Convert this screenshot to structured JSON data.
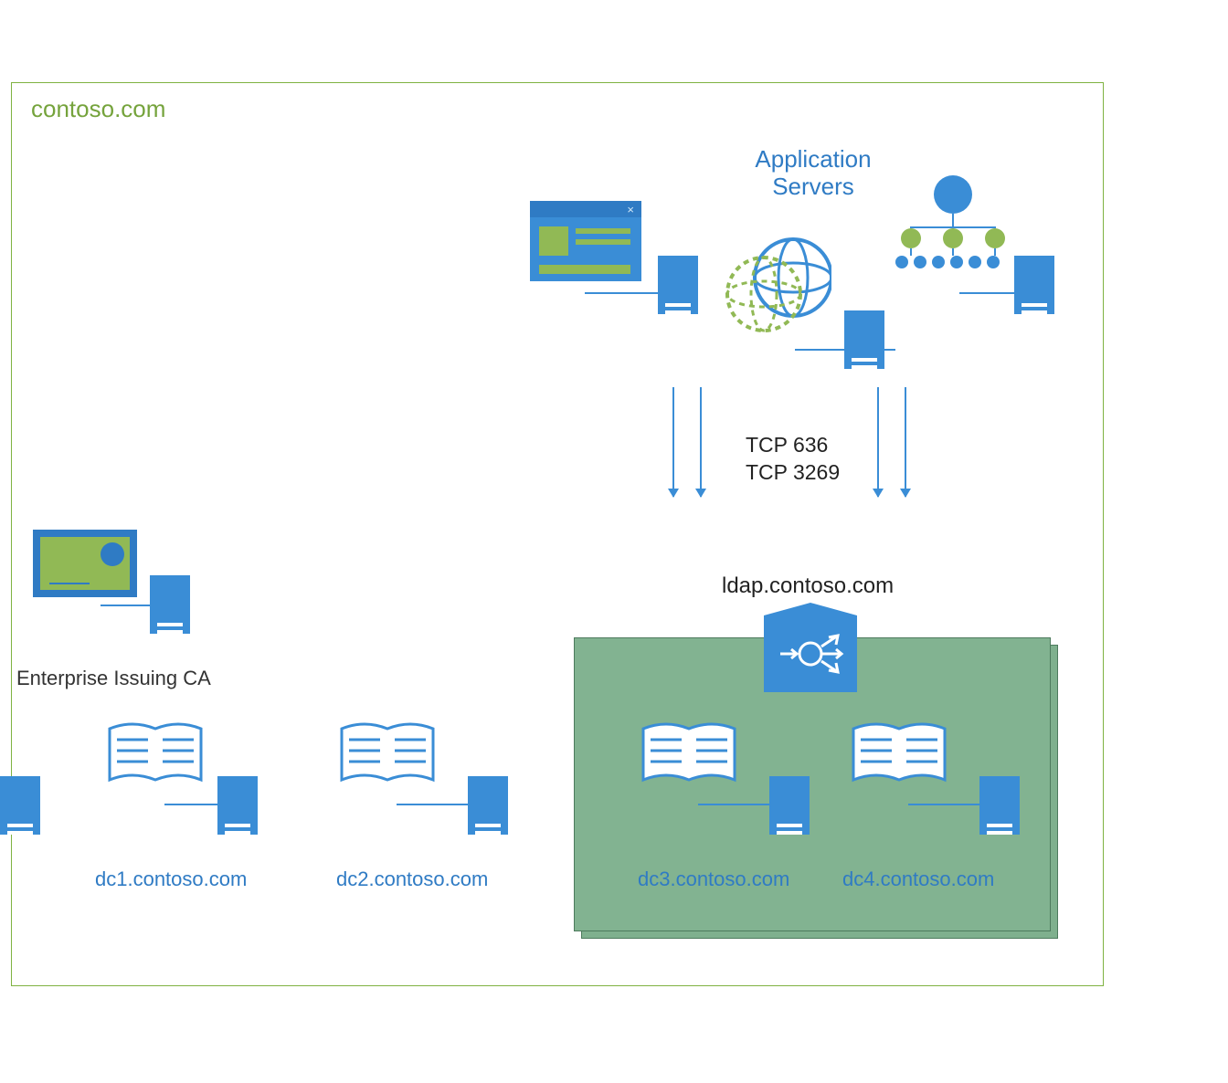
{
  "domain_label": "contoso.com",
  "app_servers_heading": "Application\nServers",
  "protocols": {
    "p1": "TCP 636",
    "p2": "TCP 3269"
  },
  "ldap_label": "ldap.contoso.com",
  "ca_label": "Enterprise Issuing CA",
  "dcs": {
    "dc1": "dc1.contoso.com",
    "dc2": "dc2.contoso.com",
    "dc3": "dc3.contoso.com",
    "dc4": "dc4.contoso.com"
  },
  "colors": {
    "accent": "#3a8dd6",
    "green": "#91b955",
    "outline": "#7fb241",
    "cluster": "#7fb08e"
  }
}
